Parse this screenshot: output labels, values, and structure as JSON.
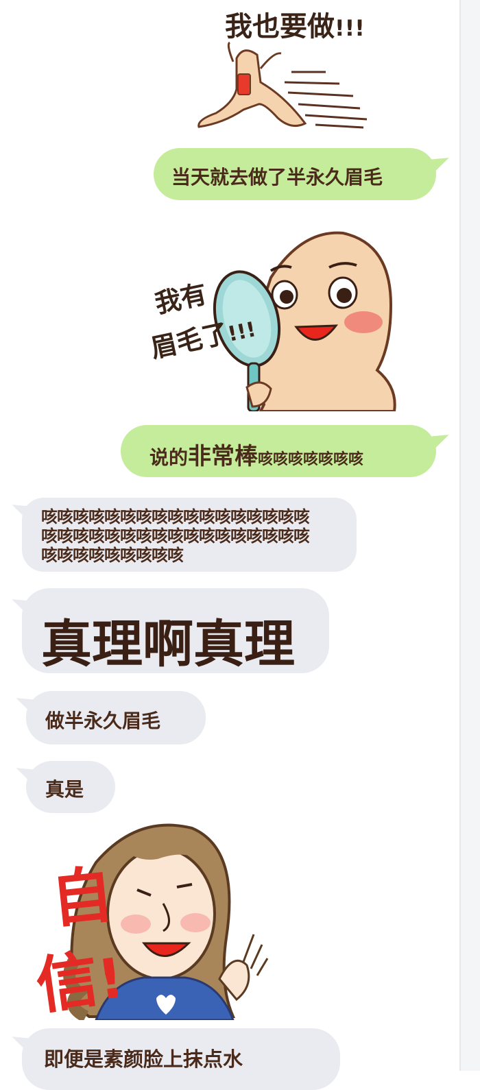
{
  "stickers": {
    "want_it": {
      "caption": "我也要做",
      "exclaim": "!!!"
    },
    "mirror": {
      "caption_line1": "我有",
      "caption_line2": "眉毛了",
      "exclaim": "!!!"
    },
    "confident": {
      "caption_char1": "自",
      "caption_char2": "信",
      "exclaim": "!"
    }
  },
  "messages": {
    "m1": {
      "text": "当天就去做了半永久眉毛"
    },
    "m2": {
      "text_a": "说的",
      "text_b": "非常棒",
      "text_c": "咳咳咳咳咳咳咳"
    },
    "m3": {
      "lines": [
        "咳咳咳咳咳咳咳咳咳咳咳咳咳咳咳咳咳",
        "咳咳咳咳咳咳咳咳咳咳咳咳咳咳咳咳咳",
        "咳咳咳咳咳咳咳咳咳"
      ]
    },
    "m4": {
      "text": "真理啊真理"
    },
    "m5": {
      "text": "做半永久眉毛"
    },
    "m6": {
      "text": "真是"
    },
    "m7": {
      "text": "即便是素颜脸上抹点水"
    }
  },
  "colors": {
    "green_bubble": "#c5ec9a",
    "gray_bubble": "#e9ebf0",
    "text_brown": "#4a2a1a",
    "red_caption": "#e32a24"
  }
}
